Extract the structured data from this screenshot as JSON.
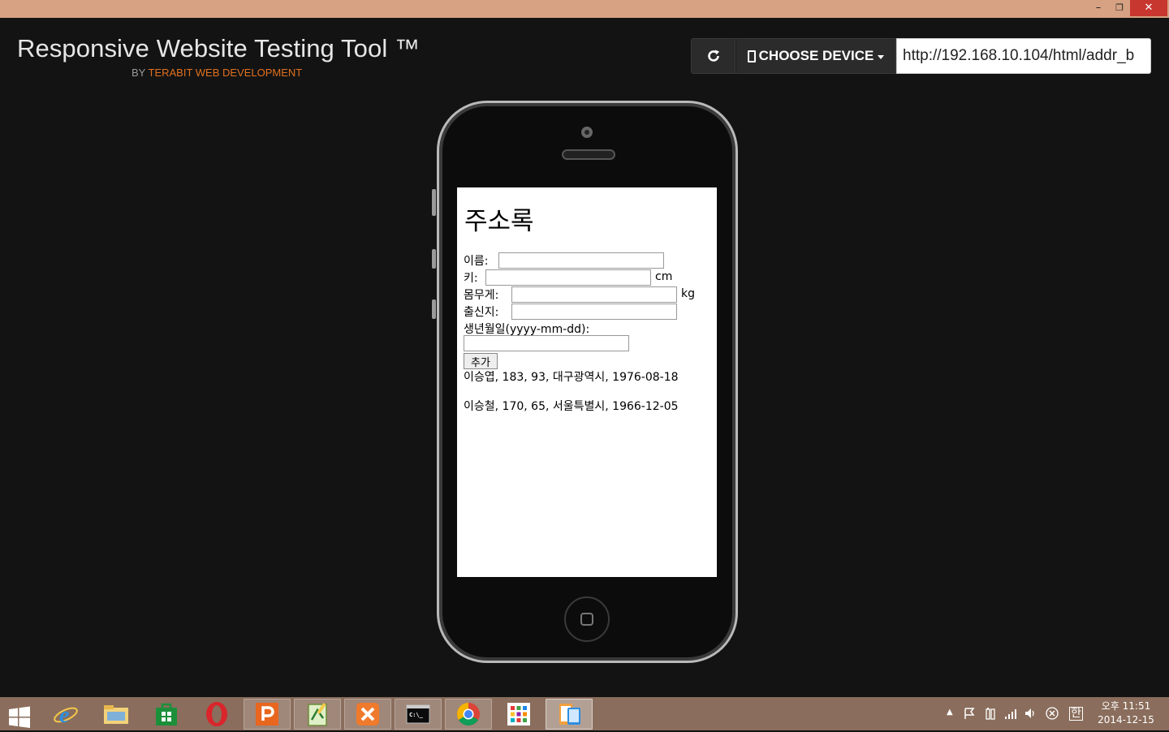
{
  "window": {
    "minimize": "–",
    "maximize": "❐",
    "close": "✕"
  },
  "header": {
    "title": "Responsive Website Testing Tool ™",
    "subtitle_prefix": "BY",
    "subtitle_brand": "TERABIT WEB DEVELOPMENT"
  },
  "toolbar": {
    "refresh_icon": "refresh-icon",
    "device_label": "CHOOSE DEVICE",
    "url_value": "http://192.168.10.104/html/addr_b"
  },
  "screen": {
    "heading": "주소록",
    "fields": [
      {
        "label": "이름:",
        "value": "",
        "unit": ""
      },
      {
        "label": "키:",
        "value": "",
        "unit": "cm"
      },
      {
        "label": "몸무게:",
        "value": "",
        "unit": "kg"
      },
      {
        "label": "출신지:",
        "value": "",
        "unit": ""
      },
      {
        "label": "생년월일(yyyy-mm-dd):",
        "value": "",
        "unit": ""
      }
    ],
    "add_button": "추가",
    "entries": [
      "이승엽, 183, 93, 대구광역시, 1976-08-18",
      "이승철, 170, 65, 서울특별시, 1966-12-05"
    ]
  },
  "taskbar": {
    "apps": [
      "internet-explorer",
      "file-explorer",
      "store",
      "opera",
      "powerpoint-viewer",
      "notepad-plus",
      "xampp",
      "command-prompt",
      "chrome",
      "apps-grid",
      "responsive-tool"
    ],
    "tray_lang": "한",
    "clock_time": "오후 11:51",
    "clock_date": "2014-12-15"
  }
}
